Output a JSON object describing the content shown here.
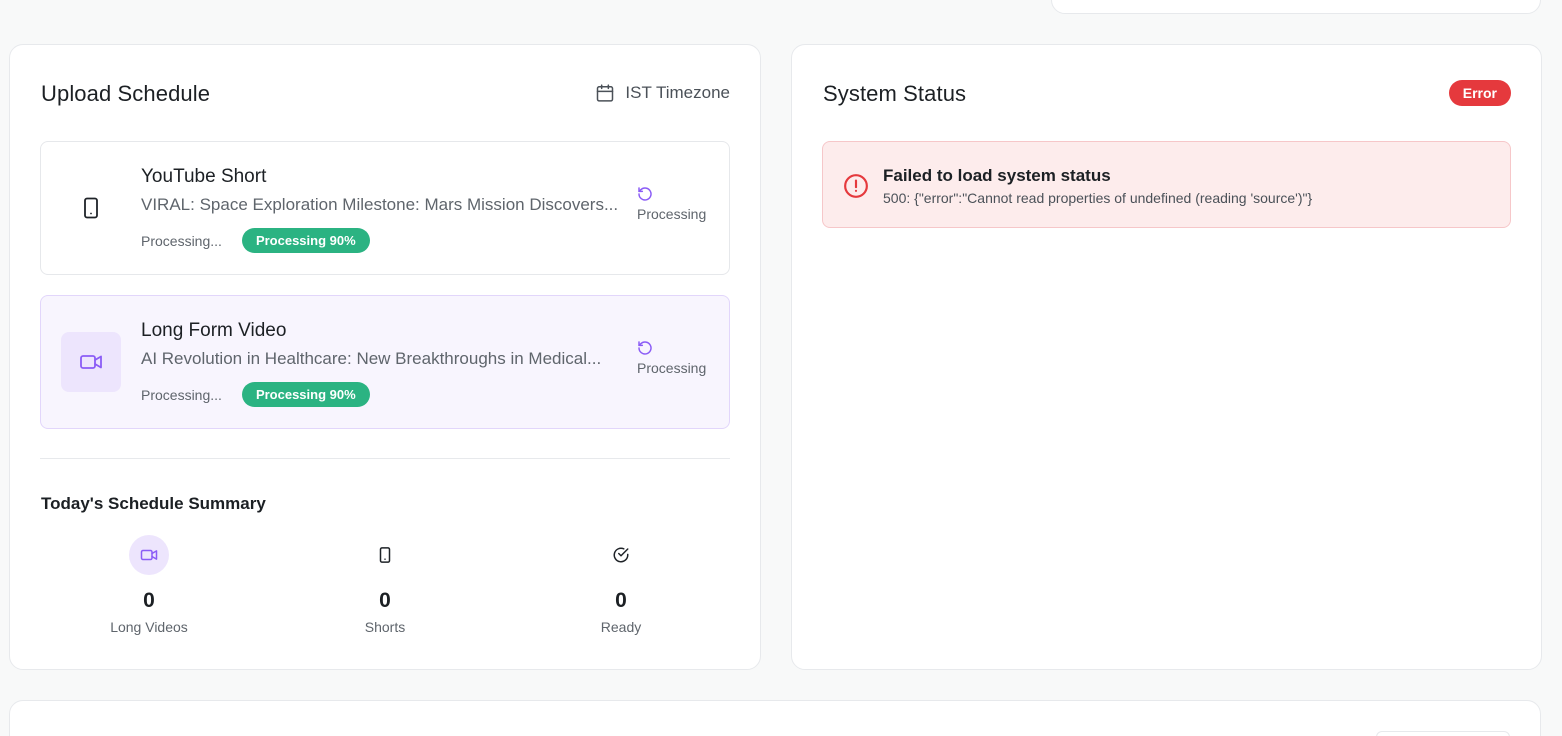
{
  "upload_schedule": {
    "title": "Upload Schedule",
    "timezone_label": "IST Timezone",
    "items": [
      {
        "type_label": "YouTube Short",
        "description": "VIRAL: Space Exploration Milestone: Mars Mission Discovers...",
        "sub_status": "Processing...",
        "progress_label": "Processing 90%",
        "progress_percent": 90,
        "state_label": "Processing",
        "icon": "smartphone-icon"
      },
      {
        "type_label": "Long Form Video",
        "description": "AI Revolution in Healthcare: New Breakthroughs in Medical...",
        "sub_status": "Processing...",
        "progress_label": "Processing 90%",
        "progress_percent": 90,
        "state_label": "Processing",
        "icon": "video-icon"
      }
    ],
    "summary": {
      "title": "Today's Schedule Summary",
      "stats": [
        {
          "value": "0",
          "label": "Long Videos",
          "icon": "video-icon"
        },
        {
          "value": "0",
          "label": "Shorts",
          "icon": "smartphone-icon"
        },
        {
          "value": "0",
          "label": "Ready",
          "icon": "check-circle-icon"
        }
      ]
    }
  },
  "system_status": {
    "title": "System Status",
    "badge": "Error",
    "alert_title": "Failed to load system status",
    "alert_message": "500: {\"error\":\"Cannot read properties of undefined (reading 'source')\"}"
  },
  "colors": {
    "accent_purple": "#8b5cf6",
    "success_green": "#2bb382",
    "error_red": "#e5393d"
  }
}
